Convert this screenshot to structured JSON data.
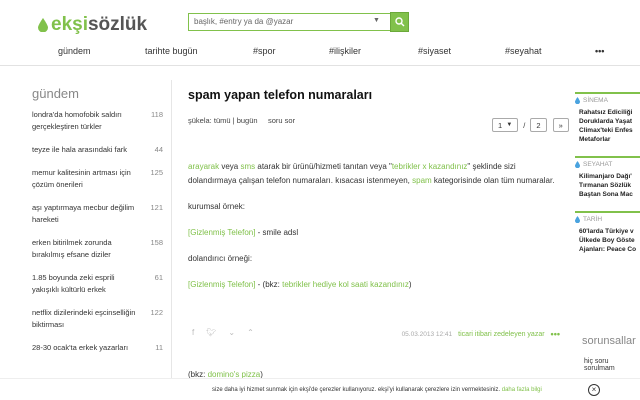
{
  "header": {
    "logo_left": "ekşi",
    "logo_right": "sözlük",
    "search_placeholder": "başlık, #entry ya da @yazar"
  },
  "nav": [
    "gündem",
    "tarihte bugün",
    "#spor",
    "#ilişkiler",
    "#siyaset",
    "#seyahat",
    "•••"
  ],
  "sidebar": {
    "title": "gündem",
    "items": [
      {
        "text": "londra'da homofobik saldırı gerçekleştiren türkler",
        "count": "118"
      },
      {
        "text": "teyze ile hala arasındaki fark",
        "count": "44"
      },
      {
        "text": "memur kalitesinin artması için çözüm önerileri",
        "count": "125"
      },
      {
        "text": "aşı yaptırmaya mecbur değilim hareketi",
        "count": "121"
      },
      {
        "text": "erken bitirilmek zorunda bırakılmış efsane diziler",
        "count": "158"
      },
      {
        "text": "1.85 boyunda zeki esprili yakışıklı kültürlü erkek",
        "count": "61"
      },
      {
        "text": "netflix dizilerindeki eşcinselliğin biktirması",
        "count": "122"
      },
      {
        "text": "28-30 ocak'ta erkek yazarları",
        "count": "11"
      }
    ]
  },
  "topic": {
    "title": "spam yapan telefon numaraları",
    "sort_label": "şükela:",
    "sort_all": "tümü",
    "sort_sep": "|",
    "sort_today": "bugün",
    "ask_link": "soru sor",
    "page_current": "1",
    "page_sep": "/",
    "page_total": "2",
    "page_next": "»"
  },
  "entry": {
    "p1_a": "arayarak",
    "p1_b": " veya ",
    "p1_c": "sms",
    "p1_d": " atarak bir ürünü/hizmeti tanıtan veya \"",
    "p1_e": "tebrikler x kazandınız",
    "p1_f": "\" şeklinde sizi dolandırmaya çalışan telefon numaraları. kısacası istenmeyen, ",
    "p1_g": "spam",
    "p1_h": " kategorisinde olan tüm numaralar.",
    "p2": "kurumsal örnek:",
    "p3_link": "[Gizlenmiş Telefon]",
    "p3_rest": " - smile adsl",
    "p4": "dolandırıcı örneği:",
    "p5_link": "[Gizlenmiş Telefon]",
    "p5_mid": " - (bkz: ",
    "p5_link2": "tebrikler hediye kol saati kazandınız",
    "p5_end": ")",
    "date": "05.03.2013 12:41",
    "author": "ticari itibari zedeleyen yazar",
    "more": "•••",
    "next_entry_a": "(bkz: ",
    "next_entry_b": "domino's pizza",
    "next_entry_c": ")"
  },
  "right": {
    "sections": [
      {
        "category": "SİNEMA",
        "lines": [
          "Rahatsız Ediciliği",
          "Doruklarda Yaşat",
          "Climax'teki Enfes",
          "Metaforlar"
        ]
      },
      {
        "category": "SEYAHAT",
        "lines": [
          "Kilimanjaro Dağı'",
          "Tırmanan Sözlük",
          "Baştan Sona Mac"
        ]
      },
      {
        "category": "TARİH",
        "lines": [
          "60'larda Türkiye v",
          "Ülkede Boy Göste",
          "Ajanları: Peace Co"
        ]
      }
    ],
    "sorun_title": "sorunsallar",
    "sorun_text": "hiç soru sorulmam"
  },
  "cookie": {
    "text": "size daha iyi hizmet sunmak için ekşi'de çerezler kullanıyoruz. ekşi'yi kullanarak çerezlere izin vermektesiniz. ",
    "link": "daha fazla bilgi",
    "close": "×"
  },
  "colors": {
    "accent": "#81c14b"
  }
}
